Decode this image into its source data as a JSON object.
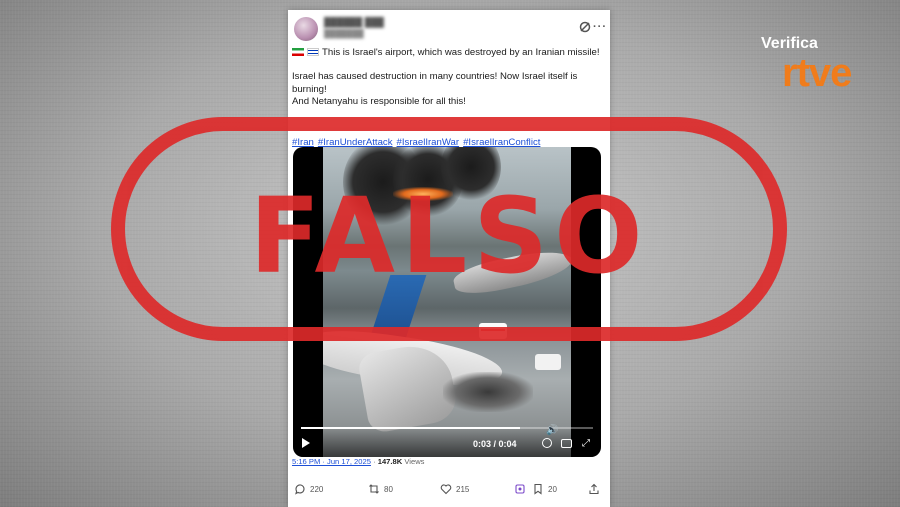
{
  "tweet": {
    "text_line1": "This is Israel's airport, which was destroyed by an Iranian missile!",
    "text_line2": "Israel has caused destruction in many countries! Now Israel itself is burning!",
    "text_line3": "And Netanyahu is responsible for all this!",
    "hashtags": [
      "#Iran",
      "#IranUnderAttack",
      "#IsraelIranWar",
      "#IsraelIranConflict"
    ],
    "timestamp": "5:16 PM · Jun 17, 2025",
    "separator": "·",
    "views_count": "147.8K",
    "views_label": "Views",
    "replies": "220",
    "reposts": "80",
    "likes": "215",
    "bookmarks": "20"
  },
  "video": {
    "time": "0:03 / 0:04",
    "progress": 0.75
  },
  "stamp": {
    "word": "FALSO",
    "color": "#dd2a2a"
  },
  "logo": {
    "top": "Verifica",
    "brand": "rtve",
    "brand_color": "#f07c1b"
  },
  "icons": [
    "grok-icon",
    "more-icon",
    "play-icon",
    "volume-icon",
    "settings-icon",
    "captions-icon",
    "fullscreen-icon",
    "reply-icon",
    "repost-icon",
    "like-icon",
    "grok-share-icon",
    "bookmark-icon",
    "share-icon"
  ]
}
